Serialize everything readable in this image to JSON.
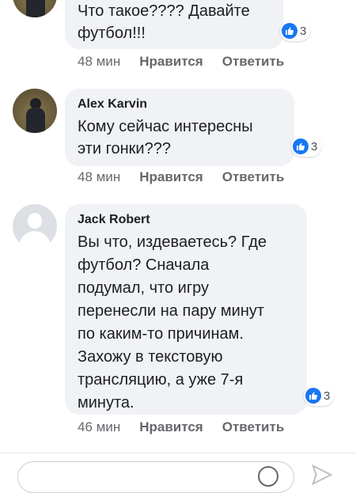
{
  "comments": [
    {
      "author": "",
      "text": "Что такое???? Давайте\nфутбол!!!",
      "likes": "3",
      "time": "48 мин",
      "like_label": "Нравится",
      "reply_label": "Ответить"
    },
    {
      "author": "Alex Karvin",
      "text": "Кому сейчас интересны\nэти гонки???",
      "likes": "3",
      "time": "48 мин",
      "like_label": "Нравится",
      "reply_label": "Ответить"
    },
    {
      "author": "Jack Robert",
      "text": "Вы что, издеваетесь? Где\nфутбол? Сначала\nподумал, что игру\nперенесли на пару минут\nпо каким-то причинам.\nЗахожу в текстовую\nтрансляцию, а уже 7-я\nминута.",
      "likes": "3",
      "time": "46 мин",
      "like_label": "Нравится",
      "reply_label": "Ответить"
    }
  ],
  "composer": {
    "placeholder": ""
  },
  "icons": {
    "like": "thumbs-up-icon",
    "emoji": "emoji-icon",
    "send": "send-icon",
    "accent": "#1877f2"
  }
}
